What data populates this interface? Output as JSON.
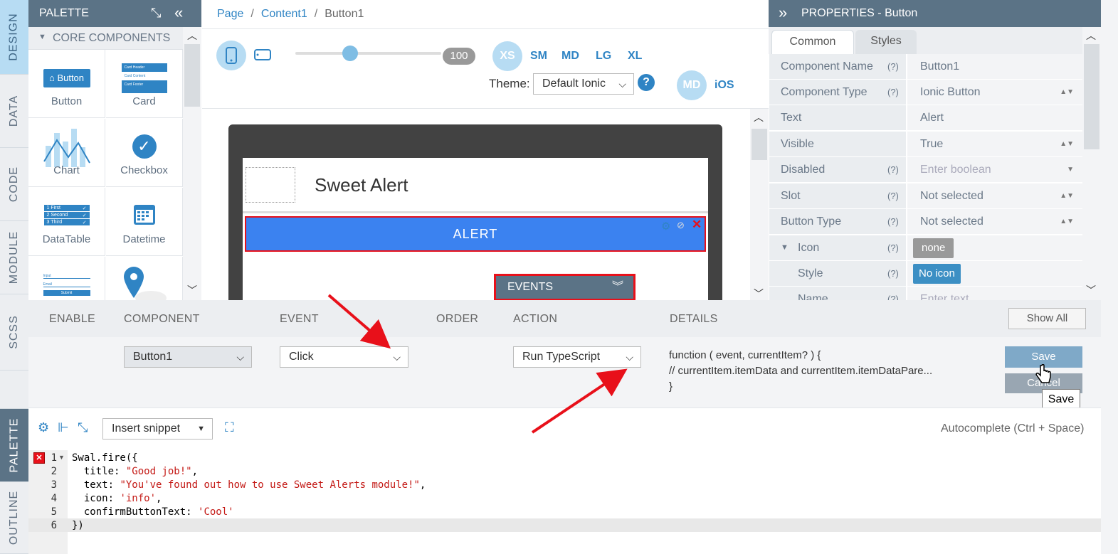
{
  "leftTabs": [
    "DESIGN",
    "DATA",
    "CODE",
    "MODULE",
    "SCSS"
  ],
  "bottomTabs": [
    "PALETTE",
    "OUTLINE"
  ],
  "palette": {
    "title": "PALETTE",
    "section": "CORE COMPONENTS",
    "items": [
      "Button",
      "Card",
      "Chart",
      "Checkbox",
      "DataTable",
      "Datetime"
    ],
    "buttonPreview": "Button",
    "cardPreview": [
      "Card Header",
      "Card Content",
      "Card Footer"
    ],
    "tablePreview": [
      "First",
      "Second",
      "Third"
    ],
    "formPreview": [
      "Input",
      "Email",
      "Submit"
    ]
  },
  "breadcrumb": [
    "Page",
    "Content1",
    "Button1"
  ],
  "toolbar": {
    "slider": "100",
    "sizes": [
      "XS",
      "SM",
      "MD",
      "LG",
      "XL"
    ],
    "themeLabel": "Theme:",
    "theme": "Default Ionic",
    "mode": "MD",
    "platform": "iOS"
  },
  "canvas": {
    "title": "Sweet Alert",
    "button": "ALERT",
    "events": "EVENTS"
  },
  "properties": {
    "title": "PROPERTIES - Button",
    "tabs": [
      "Common",
      "Styles"
    ],
    "rows": [
      {
        "label": "Component Name",
        "q": "(?)",
        "value": "Button1"
      },
      {
        "label": "Component Type",
        "q": "(?)",
        "value": "Ionic Button"
      },
      {
        "label": "Text",
        "q": "",
        "value": "Alert"
      },
      {
        "label": "Visible",
        "q": "",
        "value": "True"
      },
      {
        "label": "Disabled",
        "q": "(?)",
        "value": "Enter boolean"
      },
      {
        "label": "Slot",
        "q": "(?)",
        "value": "Not selected"
      },
      {
        "label": "Button Type",
        "q": "(?)",
        "value": "Not selected"
      },
      {
        "label": "Icon",
        "q": "(?)",
        "value": "none"
      },
      {
        "label": "Style",
        "q": "(?)",
        "value": "No icon"
      },
      {
        "label": "Name",
        "q": "(?)",
        "value": "Enter text"
      }
    ]
  },
  "events": {
    "headers": [
      "ENABLE",
      "COMPONENT",
      "EVENT",
      "ORDER",
      "ACTION",
      "DETAILS"
    ],
    "showAll": "Show All",
    "component": "Button1",
    "event": "Click",
    "action": "Run TypeScript",
    "details": [
      "function ( event, currentItem? ) {",
      "// currentItem.itemData and currentItem.itemDataPare...",
      "}"
    ],
    "save": "Save",
    "cancel": "Cancel",
    "tooltip": "Save"
  },
  "editor": {
    "snippet": "Insert snippet",
    "autocomplete": "Autocomplete (Ctrl + Space)",
    "lines": [
      "1",
      "2",
      "3",
      "4",
      "5",
      "6"
    ]
  },
  "colors": {
    "accent": "#2f84c4",
    "header": "#5b7386",
    "alertBlue": "#3b82f0",
    "annotation": "#e8101a"
  }
}
